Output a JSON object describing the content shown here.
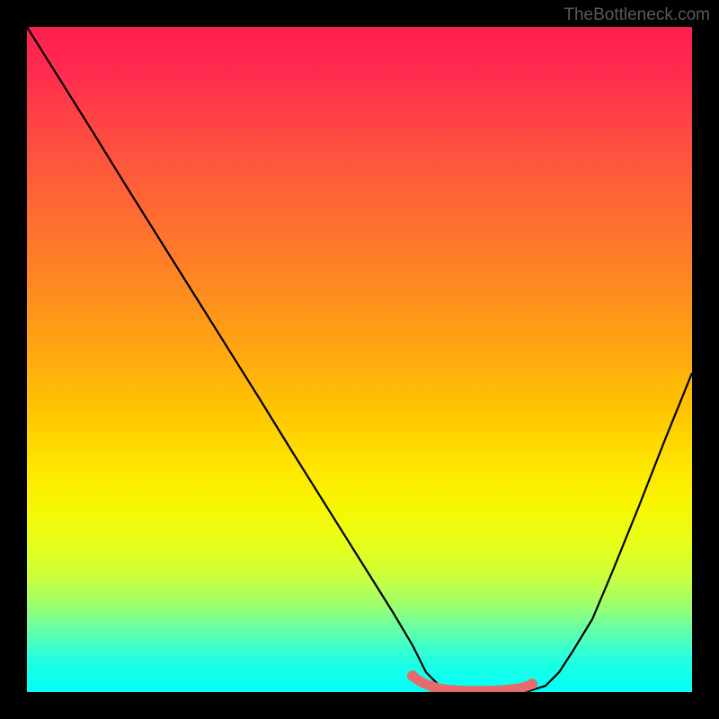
{
  "watermark": "TheBottleneck.com",
  "chart_data": {
    "type": "line",
    "title": "",
    "xlabel": "",
    "ylabel": "",
    "xlim": [
      0,
      100
    ],
    "ylim": [
      0,
      100
    ],
    "grid": false,
    "series": [
      {
        "name": "curve",
        "color": "#000000",
        "x": [
          0,
          5,
          10,
          15,
          20,
          25,
          30,
          35,
          40,
          45,
          50,
          55,
          58,
          60,
          62,
          65,
          68,
          70,
          72,
          75,
          78,
          80,
          82,
          85,
          88,
          92,
          96,
          100
        ],
        "y": [
          100,
          92,
          84,
          76,
          68,
          60,
          52,
          44,
          36,
          28,
          20,
          12,
          7,
          3,
          1,
          0,
          0,
          0,
          0,
          0,
          1,
          3,
          6,
          11,
          18,
          28,
          38,
          48
        ]
      },
      {
        "name": "highlight-dots",
        "type": "scatter",
        "color": "#e86b6b",
        "x": [
          58,
          61,
          64,
          67,
          70,
          73,
          76
        ],
        "y": [
          2.5,
          0.8,
          0.3,
          0.2,
          0.2,
          0.4,
          1.2
        ]
      }
    ],
    "background_gradient": {
      "top_color": "#ff1f52",
      "mid_color": "#ffe600",
      "bottom_color": "#00fff7"
    }
  }
}
